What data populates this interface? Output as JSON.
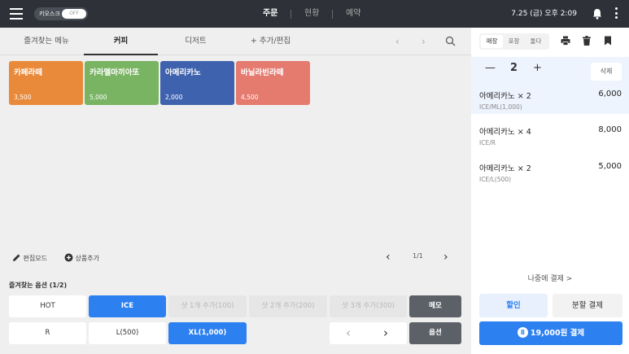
{
  "topbar": {
    "kiosk_label": "키오스크",
    "kiosk_toggle": "OFF",
    "nav": [
      "주문",
      "현황",
      "예약"
    ],
    "datetime": "7.25 (금) 오후 2:09"
  },
  "category_tabs": [
    "즐겨찾는 메뉴",
    "커피",
    "디저트",
    "+ 추가/편집"
  ],
  "tab_nav": {
    "prev": "‹",
    "next": "›"
  },
  "menu_items": [
    {
      "name": "카페라떼",
      "price": "3,500",
      "color": "#e9893a"
    },
    {
      "name": "카라멜마끼아또",
      "price": "5,000",
      "color": "#79b462"
    },
    {
      "name": "아메리카노",
      "price": "2,000",
      "color": "#3f62ae"
    },
    {
      "name": "바닐라빈라떼",
      "price": "4,500",
      "color": "#e57a6f"
    }
  ],
  "tools": {
    "edit_mode": "편집모드",
    "add_product": "상품추가",
    "page": "1/1"
  },
  "options": {
    "title": "즐겨찾는 옵션 (1/2)",
    "row1": [
      "HOT",
      "ICE",
      "샷 1개 추가(100)",
      "샷 2개 추가(200)",
      "샷 3개 추가(300)",
      "메모"
    ],
    "row2": [
      "R",
      "L(500)",
      "XL(1,000)",
      "옵션"
    ]
  },
  "order": {
    "seg": [
      "매장",
      "포장",
      "둘다"
    ],
    "qty": "2",
    "delete_label": "삭제",
    "items": [
      {
        "name": "아메리카노 × 2",
        "price": "6,000",
        "opt": "ICE/ML(1,000)"
      },
      {
        "name": "아메리카노 × 4",
        "price": "8,000",
        "opt": "ICE/R"
      },
      {
        "name": "아메리카노 × 2",
        "price": "5,000",
        "opt": "ICE/L(500)"
      }
    ],
    "pay_later": "나중에 결제 >",
    "discount": "할인",
    "split": "분할 결제",
    "pay_count": "8",
    "pay_label": "19,000원 결제"
  }
}
